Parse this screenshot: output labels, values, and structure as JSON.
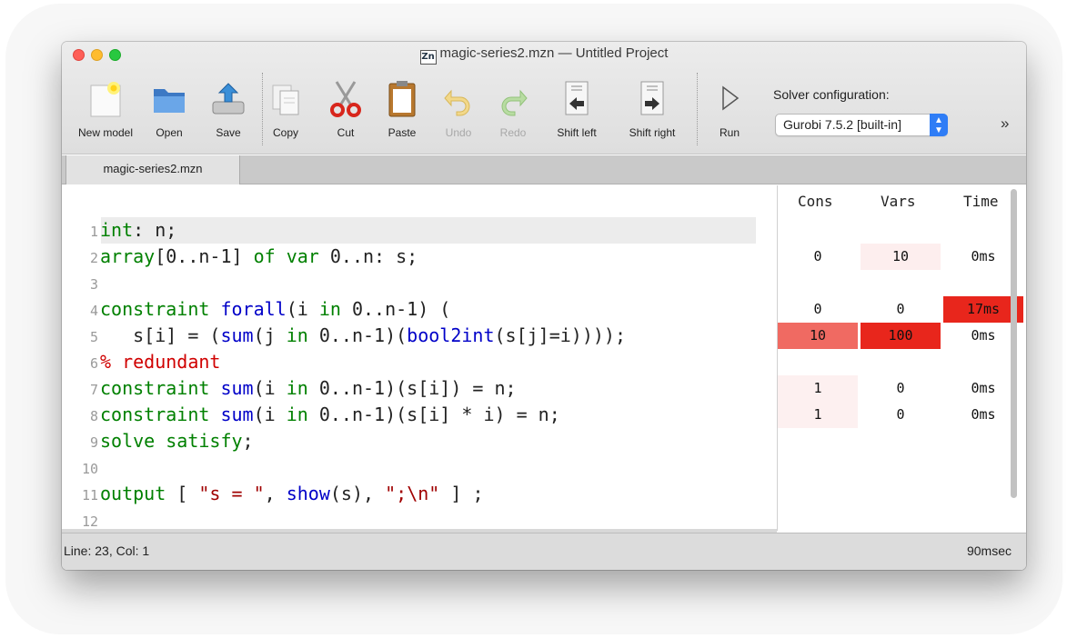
{
  "window": {
    "title": "magic-series2.mzn — Untitled Project",
    "title_icon_text": "Zn"
  },
  "toolbar": {
    "new_model": "New model",
    "open": "Open",
    "save": "Save",
    "copy": "Copy",
    "cut": "Cut",
    "paste": "Paste",
    "undo": "Undo",
    "redo": "Redo",
    "shift_left": "Shift left",
    "shift_right": "Shift right",
    "run": "Run",
    "solver_label": "Solver configuration:",
    "solver_value": "Gurobi 7.5.2 [built-in]",
    "overflow": "»"
  },
  "tabs": [
    "magic-series2.mzn"
  ],
  "editor": {
    "line_numbers": [
      "1",
      "2",
      "3",
      "4",
      "5",
      "6",
      "7",
      "8",
      "9",
      "10",
      "11",
      "12"
    ],
    "lines": [
      [
        [
          "kw",
          "int"
        ],
        [
          "op",
          ": n;"
        ]
      ],
      [
        [
          "kw",
          "array"
        ],
        [
          "op",
          "[0..n-1] "
        ],
        [
          "kw",
          "of var"
        ],
        [
          "op",
          " 0..n: s;"
        ]
      ],
      [],
      [
        [
          "kw",
          "constraint "
        ],
        [
          "fn",
          "forall"
        ],
        [
          "op",
          "(i "
        ],
        [
          "kw",
          "in"
        ],
        [
          "op",
          " 0..n-1) ("
        ]
      ],
      [
        [
          "op",
          "   s[i] = ("
        ],
        [
          "fn",
          "sum"
        ],
        [
          "op",
          "(j "
        ],
        [
          "kw",
          "in"
        ],
        [
          "op",
          " 0..n-1)("
        ],
        [
          "fn",
          "bool2int"
        ],
        [
          "op",
          "(s[j]=i))));"
        ]
      ],
      [
        [
          "cm",
          "% redundant"
        ]
      ],
      [
        [
          "kw",
          "constraint "
        ],
        [
          "fn",
          "sum"
        ],
        [
          "op",
          "(i "
        ],
        [
          "kw",
          "in"
        ],
        [
          "op",
          " 0..n-1)(s[i]) = n;"
        ]
      ],
      [
        [
          "kw",
          "constraint "
        ],
        [
          "fn",
          "sum"
        ],
        [
          "op",
          "(i "
        ],
        [
          "kw",
          "in"
        ],
        [
          "op",
          " 0..n-1)(s[i] * i) = n;"
        ]
      ],
      [
        [
          "kw",
          "solve satisfy"
        ],
        [
          "op",
          ";"
        ]
      ],
      [],
      [
        [
          "kw",
          "output"
        ],
        [
          "op",
          " [ "
        ],
        [
          "str",
          "\"s = \""
        ],
        [
          "op",
          ", "
        ],
        [
          "fn",
          "show"
        ],
        [
          "op",
          "(s), "
        ],
        [
          "str",
          "\";\\n\""
        ],
        [
          "op",
          " ] ;"
        ]
      ],
      []
    ]
  },
  "profiler": {
    "headers": [
      "Cons",
      "Vars",
      "Time"
    ],
    "rows": [
      {
        "line": 2,
        "cons": "0",
        "vars": "10",
        "time": "0ms"
      },
      {
        "line": 4,
        "cons": "0",
        "vars": "0",
        "time": "17ms"
      },
      {
        "line": 5,
        "cons": "10",
        "vars": "100",
        "time": "0ms"
      },
      {
        "line": 7,
        "cons": "1",
        "vars": "0",
        "time": "0ms"
      },
      {
        "line": 8,
        "cons": "1",
        "vars": "0",
        "time": "0ms"
      }
    ],
    "heat": {
      "2": {
        "cons": "",
        "vars": "#fdeeee",
        "time": ""
      },
      "4": {
        "cons": "",
        "vars": "",
        "time": "#e8261c"
      },
      "5": {
        "cons": "#f06a62",
        "vars": "#e8261c",
        "time": ""
      },
      "7": {
        "cons": "#fdf0f0",
        "vars": "",
        "time": ""
      },
      "8": {
        "cons": "#fdf0f0",
        "vars": "",
        "time": ""
      }
    }
  },
  "status": {
    "position": "Line: 23, Col: 1",
    "elapsed": "90msec"
  }
}
